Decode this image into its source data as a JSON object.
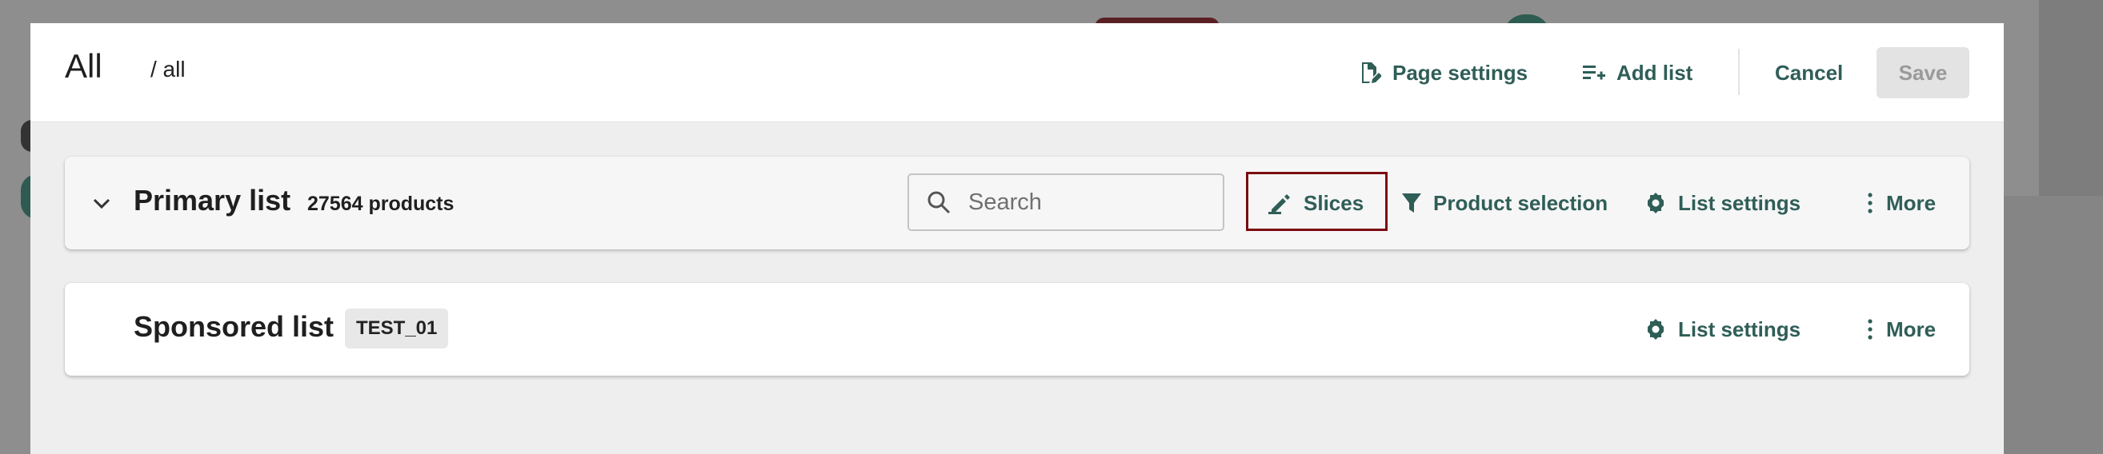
{
  "modal": {
    "title": "All",
    "breadcrumb": "/ all",
    "actions": {
      "page_settings": "Page settings",
      "add_list": "Add list",
      "cancel": "Cancel",
      "save": "Save"
    }
  },
  "lists": {
    "primary": {
      "name": "Primary list",
      "count": "27564 products",
      "search_placeholder": "Search",
      "slices": "Slices",
      "product_selection": "Product selection",
      "list_settings": "List settings",
      "more": "More"
    },
    "sponsored": {
      "name": "Sponsored list",
      "tag": "TEST_01",
      "list_settings": "List settings",
      "more": "More"
    }
  },
  "colors": {
    "accent": "#2f5e57",
    "highlight_border": "#7a0d12",
    "save_disabled_bg": "#e3e3e3"
  },
  "icons": [
    "page-settings-icon",
    "add-list-icon",
    "chevron-down-icon",
    "search-icon",
    "slices-icon",
    "filter-icon",
    "gear-icon",
    "more-vertical-icon"
  ]
}
